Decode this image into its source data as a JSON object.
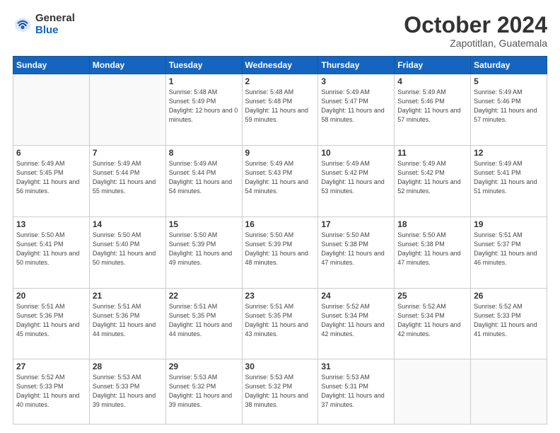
{
  "header": {
    "logo_general": "General",
    "logo_blue": "Blue",
    "month_title": "October 2024",
    "subtitle": "Zapotitlan, Guatemala"
  },
  "weekdays": [
    "Sunday",
    "Monday",
    "Tuesday",
    "Wednesday",
    "Thursday",
    "Friday",
    "Saturday"
  ],
  "weeks": [
    [
      {
        "day": "",
        "sunrise": "",
        "sunset": "",
        "daylight": ""
      },
      {
        "day": "",
        "sunrise": "",
        "sunset": "",
        "daylight": ""
      },
      {
        "day": "1",
        "sunrise": "Sunrise: 5:48 AM",
        "sunset": "Sunset: 5:49 PM",
        "daylight": "Daylight: 12 hours and 0 minutes."
      },
      {
        "day": "2",
        "sunrise": "Sunrise: 5:48 AM",
        "sunset": "Sunset: 5:48 PM",
        "daylight": "Daylight: 11 hours and 59 minutes."
      },
      {
        "day": "3",
        "sunrise": "Sunrise: 5:49 AM",
        "sunset": "Sunset: 5:47 PM",
        "daylight": "Daylight: 11 hours and 58 minutes."
      },
      {
        "day": "4",
        "sunrise": "Sunrise: 5:49 AM",
        "sunset": "Sunset: 5:46 PM",
        "daylight": "Daylight: 11 hours and 57 minutes."
      },
      {
        "day": "5",
        "sunrise": "Sunrise: 5:49 AM",
        "sunset": "Sunset: 5:46 PM",
        "daylight": "Daylight: 11 hours and 57 minutes."
      }
    ],
    [
      {
        "day": "6",
        "sunrise": "Sunrise: 5:49 AM",
        "sunset": "Sunset: 5:45 PM",
        "daylight": "Daylight: 11 hours and 56 minutes."
      },
      {
        "day": "7",
        "sunrise": "Sunrise: 5:49 AM",
        "sunset": "Sunset: 5:44 PM",
        "daylight": "Daylight: 11 hours and 55 minutes."
      },
      {
        "day": "8",
        "sunrise": "Sunrise: 5:49 AM",
        "sunset": "Sunset: 5:44 PM",
        "daylight": "Daylight: 11 hours and 54 minutes."
      },
      {
        "day": "9",
        "sunrise": "Sunrise: 5:49 AM",
        "sunset": "Sunset: 5:43 PM",
        "daylight": "Daylight: 11 hours and 54 minutes."
      },
      {
        "day": "10",
        "sunrise": "Sunrise: 5:49 AM",
        "sunset": "Sunset: 5:42 PM",
        "daylight": "Daylight: 11 hours and 53 minutes."
      },
      {
        "day": "11",
        "sunrise": "Sunrise: 5:49 AM",
        "sunset": "Sunset: 5:42 PM",
        "daylight": "Daylight: 11 hours and 52 minutes."
      },
      {
        "day": "12",
        "sunrise": "Sunrise: 5:49 AM",
        "sunset": "Sunset: 5:41 PM",
        "daylight": "Daylight: 11 hours and 51 minutes."
      }
    ],
    [
      {
        "day": "13",
        "sunrise": "Sunrise: 5:50 AM",
        "sunset": "Sunset: 5:41 PM",
        "daylight": "Daylight: 11 hours and 50 minutes."
      },
      {
        "day": "14",
        "sunrise": "Sunrise: 5:50 AM",
        "sunset": "Sunset: 5:40 PM",
        "daylight": "Daylight: 11 hours and 50 minutes."
      },
      {
        "day": "15",
        "sunrise": "Sunrise: 5:50 AM",
        "sunset": "Sunset: 5:39 PM",
        "daylight": "Daylight: 11 hours and 49 minutes."
      },
      {
        "day": "16",
        "sunrise": "Sunrise: 5:50 AM",
        "sunset": "Sunset: 5:39 PM",
        "daylight": "Daylight: 11 hours and 48 minutes."
      },
      {
        "day": "17",
        "sunrise": "Sunrise: 5:50 AM",
        "sunset": "Sunset: 5:38 PM",
        "daylight": "Daylight: 11 hours and 47 minutes."
      },
      {
        "day": "18",
        "sunrise": "Sunrise: 5:50 AM",
        "sunset": "Sunset: 5:38 PM",
        "daylight": "Daylight: 11 hours and 47 minutes."
      },
      {
        "day": "19",
        "sunrise": "Sunrise: 5:51 AM",
        "sunset": "Sunset: 5:37 PM",
        "daylight": "Daylight: 11 hours and 46 minutes."
      }
    ],
    [
      {
        "day": "20",
        "sunrise": "Sunrise: 5:51 AM",
        "sunset": "Sunset: 5:36 PM",
        "daylight": "Daylight: 11 hours and 45 minutes."
      },
      {
        "day": "21",
        "sunrise": "Sunrise: 5:51 AM",
        "sunset": "Sunset: 5:36 PM",
        "daylight": "Daylight: 11 hours and 44 minutes."
      },
      {
        "day": "22",
        "sunrise": "Sunrise: 5:51 AM",
        "sunset": "Sunset: 5:35 PM",
        "daylight": "Daylight: 11 hours and 44 minutes."
      },
      {
        "day": "23",
        "sunrise": "Sunrise: 5:51 AM",
        "sunset": "Sunset: 5:35 PM",
        "daylight": "Daylight: 11 hours and 43 minutes."
      },
      {
        "day": "24",
        "sunrise": "Sunrise: 5:52 AM",
        "sunset": "Sunset: 5:34 PM",
        "daylight": "Daylight: 11 hours and 42 minutes."
      },
      {
        "day": "25",
        "sunrise": "Sunrise: 5:52 AM",
        "sunset": "Sunset: 5:34 PM",
        "daylight": "Daylight: 11 hours and 42 minutes."
      },
      {
        "day": "26",
        "sunrise": "Sunrise: 5:52 AM",
        "sunset": "Sunset: 5:33 PM",
        "daylight": "Daylight: 11 hours and 41 minutes."
      }
    ],
    [
      {
        "day": "27",
        "sunrise": "Sunrise: 5:52 AM",
        "sunset": "Sunset: 5:33 PM",
        "daylight": "Daylight: 11 hours and 40 minutes."
      },
      {
        "day": "28",
        "sunrise": "Sunrise: 5:53 AM",
        "sunset": "Sunset: 5:33 PM",
        "daylight": "Daylight: 11 hours and 39 minutes."
      },
      {
        "day": "29",
        "sunrise": "Sunrise: 5:53 AM",
        "sunset": "Sunset: 5:32 PM",
        "daylight": "Daylight: 11 hours and 39 minutes."
      },
      {
        "day": "30",
        "sunrise": "Sunrise: 5:53 AM",
        "sunset": "Sunset: 5:32 PM",
        "daylight": "Daylight: 11 hours and 38 minutes."
      },
      {
        "day": "31",
        "sunrise": "Sunrise: 5:53 AM",
        "sunset": "Sunset: 5:31 PM",
        "daylight": "Daylight: 11 hours and 37 minutes."
      },
      {
        "day": "",
        "sunrise": "",
        "sunset": "",
        "daylight": ""
      },
      {
        "day": "",
        "sunrise": "",
        "sunset": "",
        "daylight": ""
      }
    ]
  ]
}
